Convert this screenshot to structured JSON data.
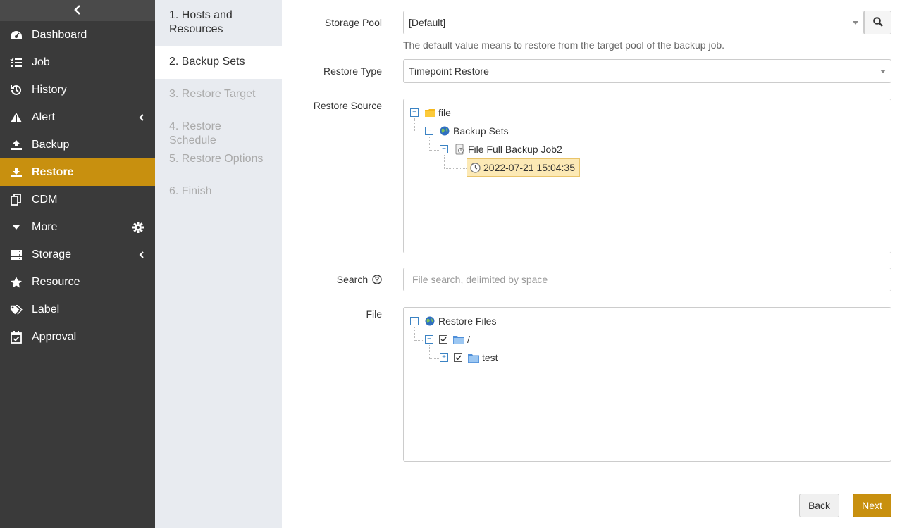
{
  "sidebar": {
    "collapse_icon": "chevron-left-icon",
    "items": [
      {
        "label": "Dashboard",
        "icon": "dashboard-icon"
      },
      {
        "label": "Job",
        "icon": "list-icon"
      },
      {
        "label": "History",
        "icon": "history-icon"
      },
      {
        "label": "Alert",
        "icon": "warning-icon"
      },
      {
        "label": "Backup",
        "icon": "upload-icon"
      },
      {
        "label": "Restore",
        "icon": "download-icon"
      },
      {
        "label": "CDM",
        "icon": "copy-icon"
      },
      {
        "label": "More",
        "icon": "caret-down-icon"
      },
      {
        "label": "Storage",
        "icon": "server-icon"
      },
      {
        "label": "Resource",
        "icon": "star-icon"
      },
      {
        "label": "Label",
        "icon": "tags-icon"
      },
      {
        "label": "Approval",
        "icon": "calendar-check-icon"
      }
    ],
    "active": "Restore",
    "accent_color": "#c8900f"
  },
  "steps": [
    {
      "label": "1. Hosts and Resources",
      "state": "done"
    },
    {
      "label": "2. Backup Sets",
      "state": "current"
    },
    {
      "label": "3. Restore Target",
      "state": "pending"
    },
    {
      "label": "4. Restore Schedule",
      "state": "pending"
    },
    {
      "label": "5. Restore Options",
      "state": "pending"
    },
    {
      "label": "6. Finish",
      "state": "pending"
    }
  ],
  "form": {
    "storage_pool": {
      "label": "Storage Pool",
      "value": "[Default]",
      "hint": "The default value means to restore from the target pool of the backup job."
    },
    "restore_type": {
      "label": "Restore Type",
      "value": "Timepoint Restore"
    },
    "restore_source": {
      "label": "Restore Source",
      "tree": {
        "root": "file",
        "backup_sets": "Backup Sets",
        "job": "File Full Backup Job2",
        "timepoint": "2022-07-21 15:04:35"
      }
    },
    "search": {
      "label": "Search",
      "placeholder": "File search, delimited by space",
      "value": ""
    },
    "file": {
      "label": "File",
      "tree": {
        "root": "Restore Files",
        "slash": "/",
        "child": "test"
      }
    }
  },
  "buttons": {
    "back": "Back",
    "next": "Next"
  }
}
